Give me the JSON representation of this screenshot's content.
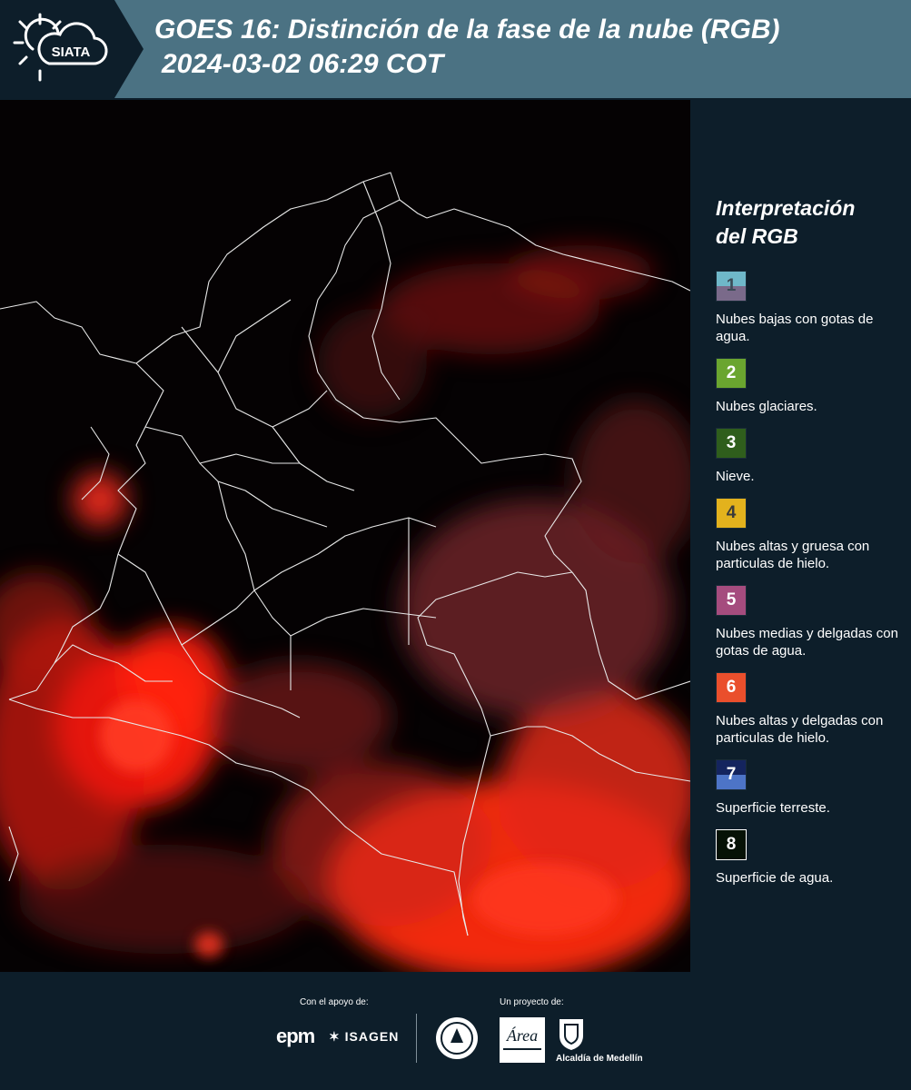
{
  "header": {
    "logo_text": "SIATA",
    "title_line1": "GOES 16: Distinción de la fase de la nube (RGB)",
    "title_line2": "2024-03-02 06:29 COT"
  },
  "legend": {
    "title_line1": "Interpretación",
    "title_line2": "del RGB",
    "items": [
      {
        "number": "1",
        "label": "Nubes bajas con gotas de agua.",
        "color_top": "#6fb8c9",
        "color_bottom": "#7a6a8a",
        "text_color": "#3a4a55"
      },
      {
        "number": "2",
        "label": "Nubes glaciares.",
        "color_top": "#6aa52f",
        "color_bottom": "#6aa52f",
        "text_color": "#ffffff"
      },
      {
        "number": "3",
        "label": "Nieve.",
        "color_top": "#2f5e1c",
        "color_bottom": "#2f5e1c",
        "text_color": "#ffffff"
      },
      {
        "number": "4",
        "label": "Nubes altas y gruesa con particulas de hielo.",
        "color_top": "#e3b21d",
        "color_bottom": "#e3b21d",
        "text_color": "#3a3a3a"
      },
      {
        "number": "5",
        "label": "Nubes medias y delgadas con gotas de agua.",
        "color_top": "#a54c7e",
        "color_bottom": "#a54c7e",
        "text_color": "#ffffff"
      },
      {
        "number": "6",
        "label": "Nubes altas y delgadas con particulas de hielo.",
        "color_top": "#ea4f2c",
        "color_bottom": "#ea4f2c",
        "text_color": "#ffffff"
      },
      {
        "number": "7",
        "label": "Superficie terreste.",
        "color_top": "#14245e",
        "color_bottom": "#4d74c7",
        "text_color": "#ffffff"
      },
      {
        "number": "8",
        "label": "Superficie de agua.",
        "color_top": "#061206",
        "color_bottom": "#061206",
        "text_color": "#ffffff"
      }
    ]
  },
  "footer": {
    "support_label": "Con el apoyo de:",
    "project_label": "Un proyecto de:",
    "epm": "epm",
    "isagen": "ISAGEN",
    "area_logo": "Área",
    "alcaldia": "Alcaldía de Medellín"
  },
  "map": {
    "land_color": "#060304",
    "cloud_color": "#ff1a0a",
    "boundary_color": "#e8e8e8"
  }
}
